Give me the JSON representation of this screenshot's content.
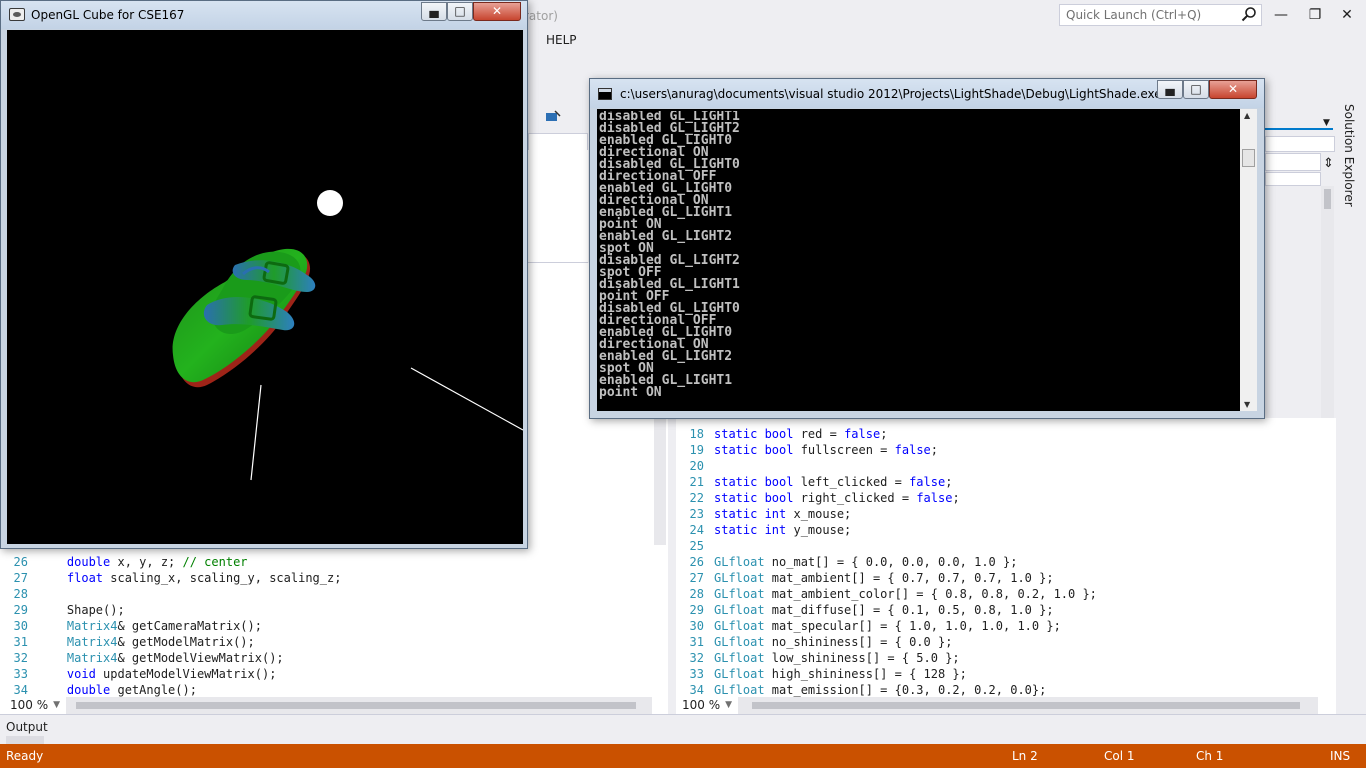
{
  "vs": {
    "title_fragment": "rator)",
    "quick_launch_placeholder": "Quick Launch (Ctrl+Q)",
    "menu": {
      "help": "HELP"
    },
    "left_editor": {
      "lines": [
        {
          "n": "26",
          "parts": [
            {
              "t": "    double",
              "c": "kw"
            },
            {
              "t": " x, y, z; ",
              "c": ""
            },
            {
              "t": "// center",
              "c": "cm"
            }
          ]
        },
        {
          "n": "27",
          "parts": [
            {
              "t": "    float",
              "c": "kw"
            },
            {
              "t": " scaling_x, scaling_y, scaling_z;",
              "c": ""
            }
          ]
        },
        {
          "n": "28",
          "parts": [
            {
              "t": "",
              "c": ""
            }
          ]
        },
        {
          "n": "29",
          "parts": [
            {
              "t": "    Shape();",
              "c": ""
            }
          ]
        },
        {
          "n": "30",
          "parts": [
            {
              "t": "    Matrix4",
              "c": "ty"
            },
            {
              "t": "& getCameraMatrix();",
              "c": ""
            }
          ]
        },
        {
          "n": "31",
          "parts": [
            {
              "t": "    Matrix4",
              "c": "ty"
            },
            {
              "t": "& getModelMatrix();",
              "c": ""
            }
          ]
        },
        {
          "n": "32",
          "parts": [
            {
              "t": "    Matrix4",
              "c": "ty"
            },
            {
              "t": "& getModelViewMatrix();",
              "c": ""
            }
          ]
        },
        {
          "n": "33",
          "parts": [
            {
              "t": "    void",
              "c": "kw"
            },
            {
              "t": " updateModelViewMatrix();",
              "c": ""
            }
          ]
        },
        {
          "n": "34",
          "parts": [
            {
              "t": "    double",
              "c": "kw"
            },
            {
              "t": " getAngle();",
              "c": ""
            }
          ]
        }
      ],
      "zoom": "100 %"
    },
    "right_editor": {
      "lines": [
        {
          "n": "18",
          "parts": [
            {
              "t": "static bool",
              "c": "kw"
            },
            {
              "t": " red = ",
              "c": ""
            },
            {
              "t": "false",
              "c": "kw"
            },
            {
              "t": ";",
              "c": ""
            }
          ]
        },
        {
          "n": "19",
          "parts": [
            {
              "t": "static bool",
              "c": "kw"
            },
            {
              "t": " fullscreen = ",
              "c": ""
            },
            {
              "t": "false",
              "c": "kw"
            },
            {
              "t": ";",
              "c": ""
            }
          ]
        },
        {
          "n": "20",
          "parts": [
            {
              "t": "",
              "c": ""
            }
          ]
        },
        {
          "n": "21",
          "parts": [
            {
              "t": "static bool",
              "c": "kw"
            },
            {
              "t": " left_clicked = ",
              "c": ""
            },
            {
              "t": "false",
              "c": "kw"
            },
            {
              "t": ";",
              "c": ""
            }
          ]
        },
        {
          "n": "22",
          "parts": [
            {
              "t": "static bool",
              "c": "kw"
            },
            {
              "t": " right_clicked = ",
              "c": ""
            },
            {
              "t": "false",
              "c": "kw"
            },
            {
              "t": ";",
              "c": ""
            }
          ]
        },
        {
          "n": "23",
          "parts": [
            {
              "t": "static int",
              "c": "kw"
            },
            {
              "t": " x_mouse;",
              "c": ""
            }
          ]
        },
        {
          "n": "24",
          "parts": [
            {
              "t": "static int",
              "c": "kw"
            },
            {
              "t": " y_mouse;",
              "c": ""
            }
          ]
        },
        {
          "n": "25",
          "parts": [
            {
              "t": "",
              "c": ""
            }
          ]
        },
        {
          "n": "26",
          "parts": [
            {
              "t": "GLfloat",
              "c": "ty"
            },
            {
              "t": " no_mat[] = { 0.0, 0.0, 0.0, 1.0 };",
              "c": ""
            }
          ]
        },
        {
          "n": "27",
          "parts": [
            {
              "t": "GLfloat",
              "c": "ty"
            },
            {
              "t": " mat_ambient[] = { 0.7, 0.7, 0.7, 1.0 };",
              "c": ""
            }
          ]
        },
        {
          "n": "28",
          "parts": [
            {
              "t": "GLfloat",
              "c": "ty"
            },
            {
              "t": " mat_ambient_color[] = { 0.8, 0.8, 0.2, 1.0 };",
              "c": ""
            }
          ]
        },
        {
          "n": "29",
          "parts": [
            {
              "t": "GLfloat",
              "c": "ty"
            },
            {
              "t": " mat_diffuse[] = { 0.1, 0.5, 0.8, 1.0 };",
              "c": ""
            }
          ]
        },
        {
          "n": "30",
          "parts": [
            {
              "t": "GLfloat",
              "c": "ty"
            },
            {
              "t": " mat_specular[] = { 1.0, 1.0, 1.0, 1.0 };",
              "c": ""
            }
          ]
        },
        {
          "n": "31",
          "parts": [
            {
              "t": "GLfloat",
              "c": "ty"
            },
            {
              "t": " no_shininess[] = { 0.0 };",
              "c": ""
            }
          ]
        },
        {
          "n": "32",
          "parts": [
            {
              "t": "GLfloat",
              "c": "ty"
            },
            {
              "t": " low_shininess[] = { 5.0 };",
              "c": ""
            }
          ]
        },
        {
          "n": "33",
          "parts": [
            {
              "t": "GLfloat",
              "c": "ty"
            },
            {
              "t": " high_shininess[] = { 128 };",
              "c": ""
            }
          ]
        },
        {
          "n": "34",
          "parts": [
            {
              "t": "GLfloat",
              "c": "ty"
            },
            {
              "t": " mat_emission[] = {0.3, 0.2, 0.2, 0.0};",
              "c": ""
            }
          ]
        }
      ],
      "zoom": "100 %"
    },
    "output_label": "Output",
    "solution_explorer": "Solution Explorer",
    "status": {
      "ready": "Ready",
      "ln": "Ln 2",
      "col": "Col 1",
      "ch": "Ch 1",
      "ins": "INS"
    },
    "status_color": "#ca5100",
    "accent": "#007acc"
  },
  "gl_window": {
    "title": "OpenGL Cube for CSE167",
    "shape_colors": {
      "main": "#1fa81a",
      "shade": "#2a6fb0",
      "edge": "#b02020"
    }
  },
  "console": {
    "title": "c:\\users\\anurag\\documents\\visual studio 2012\\Projects\\LightShade\\Debug\\LightShade.exe",
    "lines": [
      "disabled GL_LIGHT1",
      "disabled GL_LIGHT2",
      "enabled GL_LIGHT0",
      "directional ON",
      "disabled GL_LIGHT0",
      "directional OFF",
      "enabled GL_LIGHT0",
      "directional ON",
      "enabled GL_LIGHT1",
      "point ON",
      "enabled GL_LIGHT2",
      "spot ON",
      "disabled GL_LIGHT2",
      "spot OFF",
      "disabled GL_LIGHT1",
      "point OFF",
      "disabled GL_LIGHT0",
      "directional OFF",
      "enabled GL_LIGHT0",
      "directional ON",
      "enabled GL_LIGHT2",
      "spot ON",
      "enabled GL_LIGHT1",
      "point ON"
    ]
  }
}
